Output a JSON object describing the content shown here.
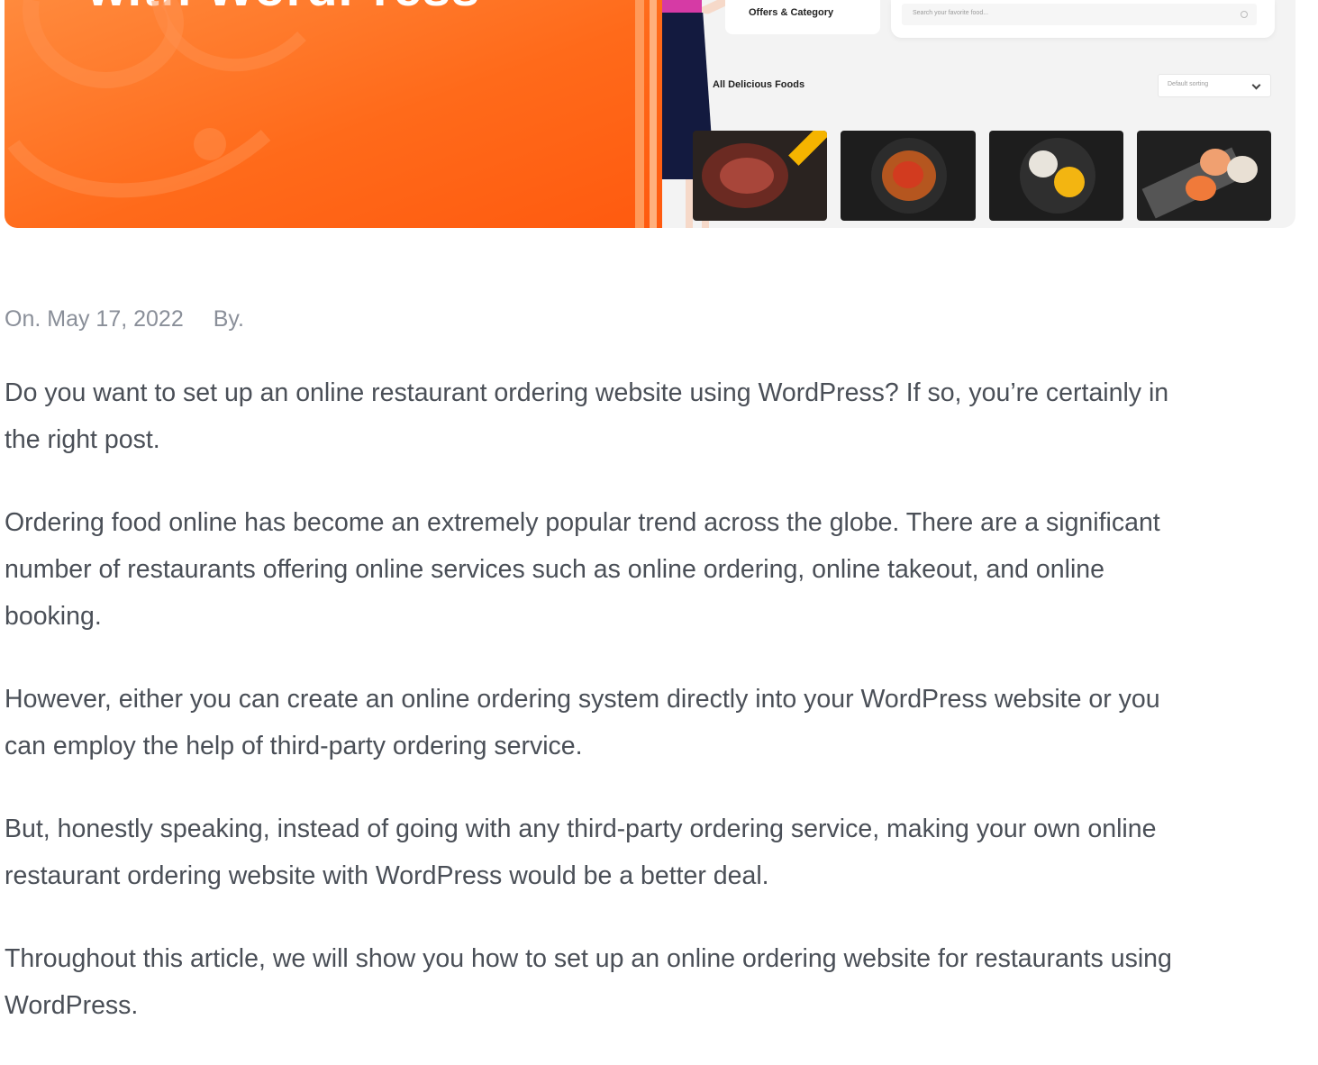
{
  "hero": {
    "title": "with WordPress",
    "offers_label": "Offers & Category",
    "search_placeholder": "Search your favorite food...",
    "foods_label": "All Delicious Foods",
    "sort_label": "Default sorting",
    "food_items": [
      "steak",
      "noodles",
      "chicken-bites",
      "sushi"
    ],
    "colors": {
      "orange": "#ff6a1a",
      "navy": "#131a3f",
      "pink": "#d63aa5"
    }
  },
  "meta": {
    "date": "On. May 17, 2022",
    "author": "By."
  },
  "article": {
    "paragraphs": [
      [
        "Do you want to set up an online restaurant ordering website using WordPress? If so, you’re certainly in",
        "the right post."
      ],
      [
        "Ordering food online has become an extremely popular trend across the globe. There are a significant",
        "number of restaurants offering online services such as online ordering, online takeout, and online",
        "booking."
      ],
      [
        "However, either you can create an online ordering system directly into your WordPress website or you",
        "can employ the help of third-party ordering service."
      ],
      [
        "But, honestly speaking, instead of going with any third-party ordering service, making your own online",
        "restaurant ordering website with WordPress would be a better deal."
      ],
      [
        "Throughout this article, we will show you how to set up an online ordering website for restaurants using",
        "WordPress."
      ]
    ]
  }
}
